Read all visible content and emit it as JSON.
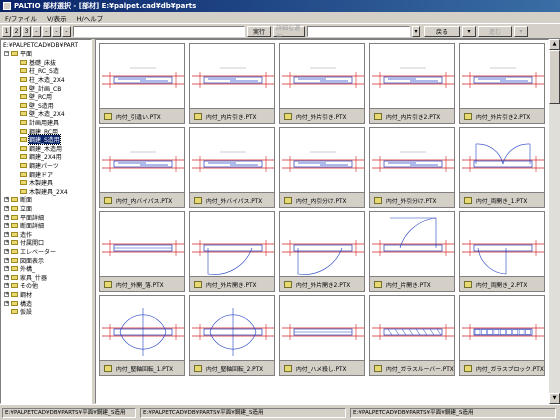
{
  "window": {
    "title": "PALTIO 部材選択 - [部材] E:¥palpet.cad¥db¥parts"
  },
  "menu": [
    "F/ファイル",
    "V/表示",
    "H/ヘルプ"
  ],
  "toolbar": {
    "level_buttons": [
      "1",
      "2",
      "3",
      "-",
      "-",
      "-",
      "-"
    ],
    "execute_label": "実行",
    "detail_label": "詳細な選択",
    "back_label": "戻る",
    "forward_label": "進む"
  },
  "tree": {
    "root": "E:¥PALPETCAD¥DB¥PART",
    "items": [
      {
        "label": "平面",
        "level": 1,
        "type": "folder",
        "expanded": true
      },
      {
        "label": "基礎_床抜",
        "level": 2,
        "type": "folder"
      },
      {
        "label": "柱_RC_S造",
        "level": 2,
        "type": "folder"
      },
      {
        "label": "柱_木造_2X4",
        "level": 2,
        "type": "folder"
      },
      {
        "label": "壁_計画_CB",
        "level": 2,
        "type": "folder"
      },
      {
        "label": "壁_RC用",
        "level": 2,
        "type": "folder"
      },
      {
        "label": "壁_S造用",
        "level": 2,
        "type": "folder"
      },
      {
        "label": "壁_木造_2X4",
        "level": 2,
        "type": "folder"
      },
      {
        "label": "計画用建具",
        "level": 2,
        "type": "folder"
      },
      {
        "label": "鋼建_RC用",
        "level": 2,
        "type": "folder"
      },
      {
        "label": "鋼建_S造用",
        "level": 2,
        "type": "folder",
        "selected": true
      },
      {
        "label": "鋼建_木造用",
        "level": 2,
        "type": "folder"
      },
      {
        "label": "鋼建_2X4用",
        "level": 2,
        "type": "folder"
      },
      {
        "label": "鋼建パーツ",
        "level": 2,
        "type": "folder"
      },
      {
        "label": "鋼建ドア",
        "level": 2,
        "type": "folder"
      },
      {
        "label": "木製建具",
        "level": 2,
        "type": "folder"
      },
      {
        "label": "木製建具_2X4",
        "level": 2,
        "type": "folder"
      },
      {
        "label": "断面",
        "level": 1,
        "type": "folder",
        "expandable": true
      },
      {
        "label": "立面",
        "level": 1,
        "type": "folder",
        "expandable": true
      },
      {
        "label": "平面詳細",
        "level": 1,
        "type": "folder",
        "expandable": true
      },
      {
        "label": "断面詳細",
        "level": 1,
        "type": "folder",
        "expandable": true
      },
      {
        "label": "造作",
        "level": 1,
        "type": "folder",
        "expandable": true
      },
      {
        "label": "付属開口",
        "level": 1,
        "type": "folder",
        "expandable": true
      },
      {
        "label": "エレベーター",
        "level": 1,
        "type": "folder",
        "expandable": true
      },
      {
        "label": "図面表示",
        "level": 1,
        "type": "folder",
        "expandable": true
      },
      {
        "label": "外構_",
        "level": 1,
        "type": "folder",
        "expandable": true
      },
      {
        "label": "家具_什器",
        "level": 1,
        "type": "folder",
        "expandable": true
      },
      {
        "label": "その他",
        "level": 1,
        "type": "folder",
        "expandable": true
      },
      {
        "label": "鋼材",
        "level": 1,
        "type": "folder",
        "expandable": true
      },
      {
        "label": "構造",
        "level": 1,
        "type": "folder",
        "expandable": true
      },
      {
        "label": "仮設",
        "level": 1,
        "type": "folder"
      }
    ]
  },
  "parts": [
    {
      "label": "内付_引違い.PTX",
      "drawing": "sliding"
    },
    {
      "label": "内付_内片引き.PTX",
      "drawing": "sliding"
    },
    {
      "label": "内付_外片引き.PTX",
      "drawing": "sliding"
    },
    {
      "label": "内付_内片引き2.PTX",
      "drawing": "sliding"
    },
    {
      "label": "内付_外片引き2.PTX",
      "drawing": "sliding"
    },
    {
      "label": "内付_内バイパス.PTX",
      "drawing": "sliding"
    },
    {
      "label": "内付_外バイパス.PTX",
      "drawing": "sliding"
    },
    {
      "label": "内付_内引分け.PTX",
      "drawing": "sliding"
    },
    {
      "label": "内付_外引分け.PTX",
      "drawing": "sliding"
    },
    {
      "label": "内付_両開き_1.PTX",
      "drawing": "double-swing"
    },
    {
      "label": "内付_外開_落.PTX",
      "drawing": "plain"
    },
    {
      "label": "内付_外片開き.PTX",
      "drawing": "swing"
    },
    {
      "label": "内付_外片開き2.PTX",
      "drawing": "swing2"
    },
    {
      "label": "内付_片開き.PTX",
      "drawing": "swing3"
    },
    {
      "label": "内付_両開き_2.PTX",
      "drawing": "swing4"
    },
    {
      "label": "内付_堅軸回転_1.PTX",
      "drawing": "pivot"
    },
    {
      "label": "内付_堅軸回転_2.PTX",
      "drawing": "pivot"
    },
    {
      "label": "内付_ハメ殺し.PTX",
      "drawing": "plain"
    },
    {
      "label": "内付_ガラスルーバー.PTX",
      "drawing": "louver"
    },
    {
      "label": "内付_ガラスブロック.PTX",
      "drawing": "block"
    }
  ],
  "status": {
    "left": "E:¥PALPETCAD¥DB¥PARTS¥平面¥鋼建_S造用",
    "middle": "E:¥PALPETCAD¥DB¥PARTS¥平面¥鋼建_S造用",
    "right": "E:¥PALPETCAD¥DB¥PARTS¥平面¥鋼建_S造用"
  },
  "colors": {
    "selection": "#0a246a",
    "title_start": "#0a246a",
    "title_end": "#3a6ea5",
    "drawing_red": "#d02020",
    "drawing_blue": "#2040c0"
  }
}
